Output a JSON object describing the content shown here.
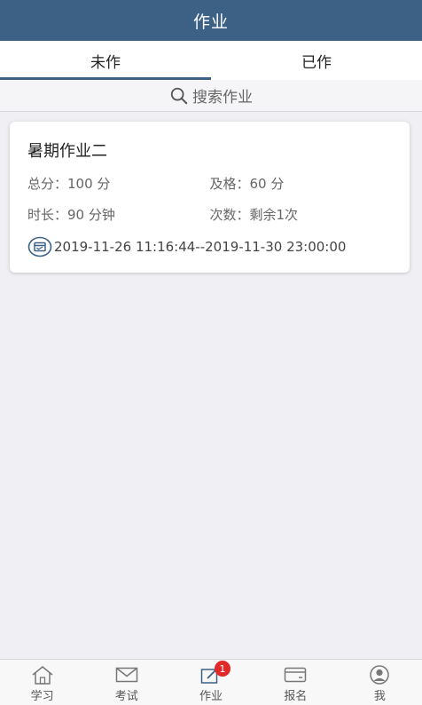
{
  "header": {
    "title": "作业"
  },
  "tabs": [
    {
      "label": "未作",
      "active": true
    },
    {
      "label": "已作",
      "active": false
    }
  ],
  "search": {
    "label": "搜索作业",
    "icon": "search-icon"
  },
  "homework_list": [
    {
      "title": "暑期作业二",
      "total_score_label": "总分：",
      "total_score_value": "100 分",
      "pass_label": "及格：",
      "pass_value": "60 分",
      "duration_label": "时长：",
      "duration_value": "90 分钟",
      "attempts_label": "次数：",
      "attempts_value": "剩余1次",
      "time_range": "2019-11-26 11:16:44--2019-11-30 23:00:00"
    }
  ],
  "bottom_nav": [
    {
      "label": "学习",
      "icon": "home-icon"
    },
    {
      "label": "考试",
      "icon": "mail-icon"
    },
    {
      "label": "作业",
      "icon": "edit-icon",
      "badge": "1"
    },
    {
      "label": "报名",
      "icon": "card-icon"
    },
    {
      "label": "我",
      "icon": "user-icon"
    }
  ],
  "colors": {
    "header_bg": "#3c6185",
    "page_bg": "#efeff4",
    "badge_bg": "#e02a2a"
  }
}
